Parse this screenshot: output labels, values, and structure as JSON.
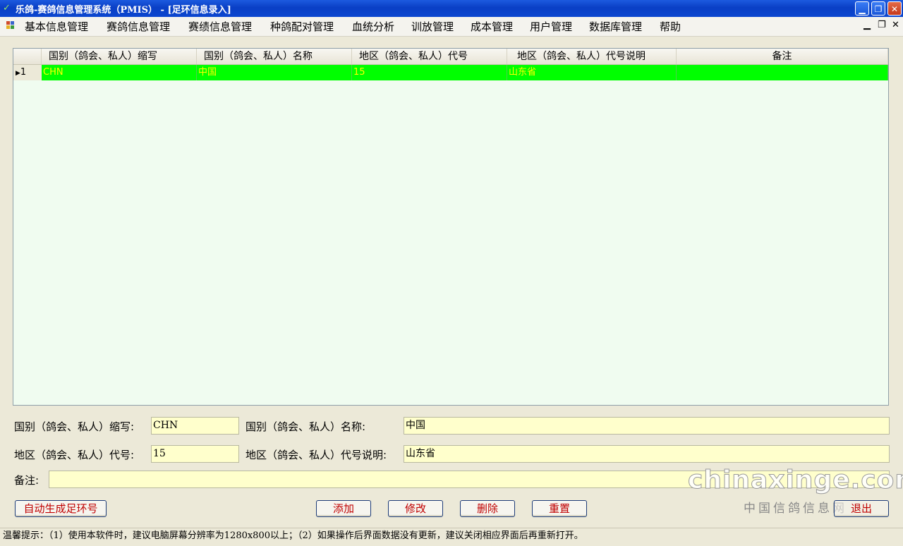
{
  "window": {
    "title": "乐鸽-赛鸽信息管理系统（PMIS） - [足环信息录入]"
  },
  "menu": [
    "基本信息管理",
    "赛鸽信息管理",
    "赛绩信息管理",
    "种鸽配对管理",
    "血统分析",
    "训放管理",
    "成本管理",
    "用户管理",
    "数据库管理",
    "帮助"
  ],
  "grid": {
    "columns": [
      "国别（鸽会、私人）缩写",
      "国别（鸽会、私人）名称",
      "地区（鸽会、私人）代号",
      "地区（鸽会、私人）代号说明",
      "备注"
    ],
    "rows": [
      {
        "num": "1",
        "abbr": "CHN",
        "name": "中国",
        "code": "15",
        "desc": "山东省",
        "note": ""
      }
    ]
  },
  "form": {
    "abbr_label": "国别（鸽会、私人）缩写:",
    "abbr_value": "CHN",
    "name_label": "国别（鸽会、私人）名称:",
    "name_value": "中国",
    "code_label": "地区（鸽会、私人）代号:",
    "code_value": "15",
    "desc_label": "地区（鸽会、私人）代号说明:",
    "desc_value": "山东省",
    "note_label": "备注:",
    "note_value": ""
  },
  "buttons": {
    "auto": "自动生成足环号",
    "add": "添加",
    "edit": "修改",
    "delete": "删除",
    "reset": "重置",
    "exit": "退出"
  },
  "status": "温馨提示：（1）使用本软件时，建议电脑屏幕分辨率为1280x800以上；（2）如果操作后界面数据没有更新，建议关闭相应界面后再重新打开。",
  "watermark": {
    "logo": "chinaxinge.com",
    "sub": "中国信鸽信息网"
  },
  "colors": {
    "selected_row": "#00ff00",
    "selected_text": "#ffff00",
    "field_bg": "#ffffcc",
    "grid_bg": "#f0fcf0"
  }
}
